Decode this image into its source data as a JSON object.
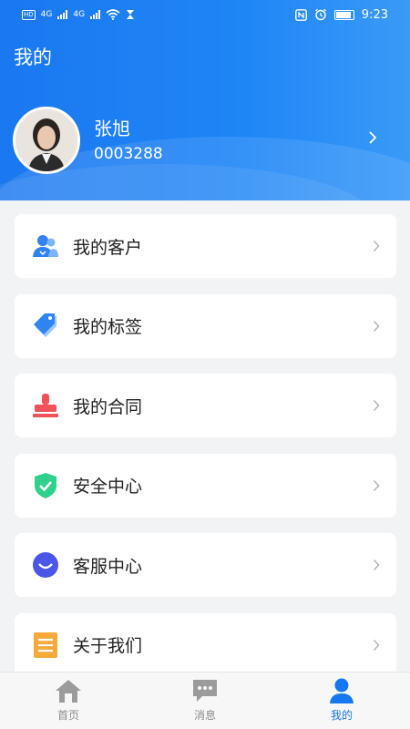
{
  "status_bar": {
    "network_left_1": "4G",
    "network_left_2": "4G",
    "time": "9:23",
    "hd_label": "HD"
  },
  "header": {
    "title": "我的"
  },
  "profile": {
    "name": "张旭",
    "id": "0003288"
  },
  "menu": {
    "items": [
      {
        "label": "我的客户",
        "icon": "customers-icon"
      },
      {
        "label": "我的标签",
        "icon": "tag-icon"
      },
      {
        "label": "我的合同",
        "icon": "stamp-icon"
      },
      {
        "label": "安全中心",
        "icon": "shield-icon"
      },
      {
        "label": "客服中心",
        "icon": "customer-service-icon"
      },
      {
        "label": "关于我们",
        "icon": "document-icon"
      }
    ]
  },
  "tabbar": {
    "tabs": [
      {
        "label": "首页",
        "icon": "home-icon",
        "active": false
      },
      {
        "label": "消息",
        "icon": "message-icon",
        "active": false
      },
      {
        "label": "我的",
        "icon": "user-icon",
        "active": true
      }
    ]
  },
  "colors": {
    "brand": "#1a78f0",
    "active_tab": "#1677f2",
    "inactive_tab": "#8a8a8a",
    "shield": "#2fd28c",
    "stamp": "#f0525a",
    "document": "#f7a93a"
  }
}
